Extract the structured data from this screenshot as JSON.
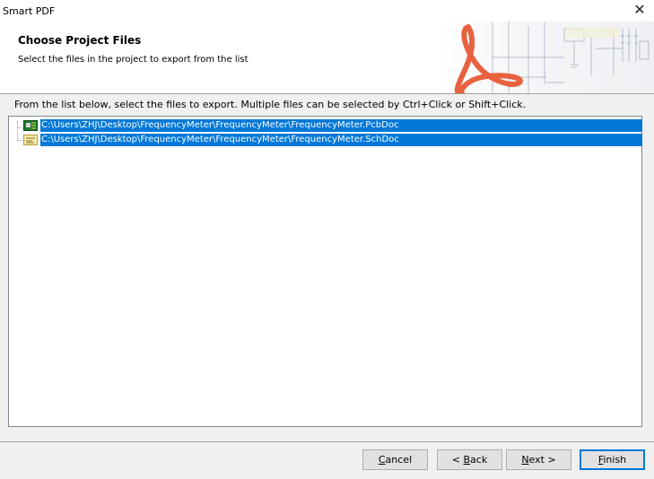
{
  "window": {
    "title": "Smart PDF",
    "close_glyph": "✕"
  },
  "header": {
    "title": "Choose Project Files",
    "subtitle": "Select the files in the project to export from the list"
  },
  "instructions": "From the list below, select the files to export. Multiple files can be selected by Ctrl+Click or Shift+Click.",
  "file_list": {
    "files": [
      {
        "path": "C:\\Users\\ZHJ\\Desktop\\FrequencyMeter\\FrequencyMeter\\FrequencyMeter.PcbDoc",
        "icon": "pcb-document-icon",
        "selected": true
      },
      {
        "path": "C:\\Users\\ZHJ\\Desktop\\FrequencyMeter\\FrequencyMeter\\FrequencyMeter.SchDoc",
        "icon": "schematic-document-icon",
        "selected": true
      }
    ]
  },
  "buttons": {
    "cancel": {
      "prefix": "",
      "mnemonic": "C",
      "rest": "ancel"
    },
    "back": {
      "prefix": "< ",
      "mnemonic": "B",
      "rest": "ack"
    },
    "next": {
      "prefix": "",
      "mnemonic": "N",
      "rest": "ext >"
    },
    "finish": {
      "prefix": "",
      "mnemonic": "F",
      "rest": "inish"
    }
  },
  "colors": {
    "selection": "#0078d7",
    "default_button_border": "#0078d7",
    "pdf_logo": "#e8623f"
  }
}
